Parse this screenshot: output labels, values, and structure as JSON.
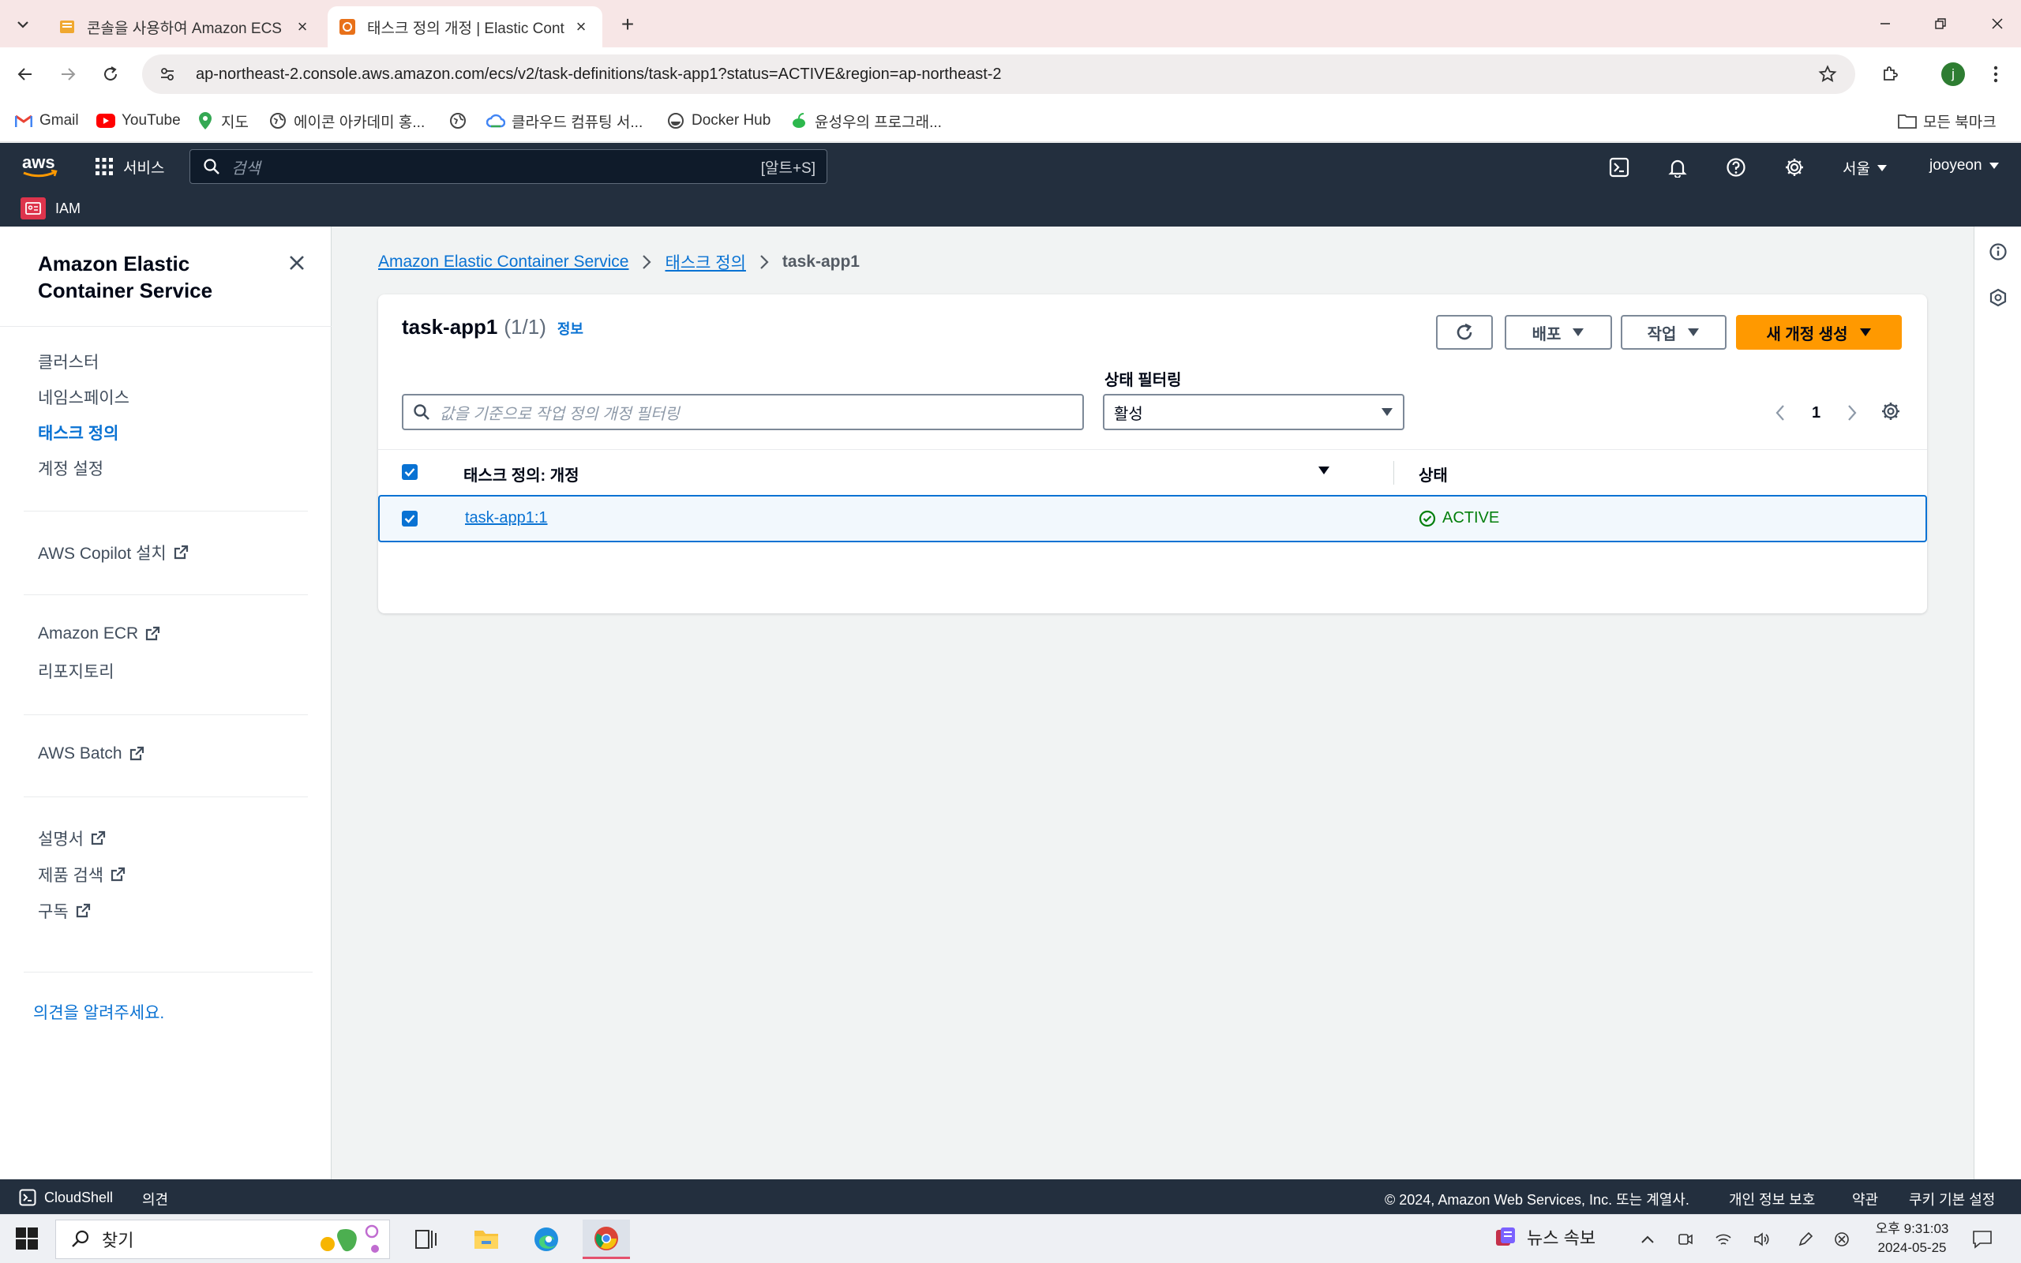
{
  "browser": {
    "tabs": [
      {
        "title": "콘솔을 사용하여 Amazon ECS",
        "active": false
      },
      {
        "title": "태스크 정의 개정 | Elastic Cont",
        "active": true
      }
    ],
    "url": "ap-northeast-2.console.aws.amazon.com/ecs/v2/task-definitions/task-app1?status=ACTIVE&region=ap-northeast-2",
    "profile_initial": "j",
    "bookmarks": [
      "Gmail",
      "YouTube",
      "지도",
      "에이콘 아카데미 홍...",
      "",
      "클라우드 컴퓨팅 서...",
      "Docker Hub",
      "윤성우의 프로그래..."
    ],
    "all_bookmarks": "모든 북마크"
  },
  "aws_nav": {
    "logo": "aws",
    "services": "서비스",
    "search_placeholder": "검색",
    "search_shortcut": "[알트+S]",
    "region": "서울",
    "user": "jooyeon",
    "favorite": "IAM"
  },
  "sidenav": {
    "title": "Amazon Elastic Container Service",
    "items": [
      "클러스터",
      "네임스페이스",
      "태스크 정의",
      "계정 설정"
    ],
    "active_item": "태스크 정의",
    "links": [
      "AWS Copilot 설치",
      "Amazon ECR",
      "리포지토리",
      "AWS Batch",
      "설명서",
      "제품 검색",
      "구독"
    ],
    "feedback": "의견을 알려주세요."
  },
  "breadcrumb": [
    "Amazon Elastic Container Service",
    "태스크 정의",
    "task-app1"
  ],
  "panel": {
    "title": "task-app1",
    "count": "(1/1)",
    "info": "정보",
    "buttons": {
      "deploy": "배포",
      "actions": "작업",
      "create": "새 개정 생성"
    },
    "filter_placeholder": "값을 기준으로 작업 정의 개정 필터링",
    "status_filter_label": "상태 필터링",
    "status_filter_value": "활성",
    "page": "1",
    "columns": [
      "태스크 정의: 개정",
      "상태"
    ],
    "rows": [
      {
        "revision": "task-app1:1",
        "status": "ACTIVE",
        "selected": true
      }
    ]
  },
  "footer": {
    "cloudshell": "CloudShell",
    "feedback": "의견",
    "copyright": "© 2024, Amazon Web Services, Inc. 또는 계열사.",
    "privacy": "개인 정보 보호",
    "terms": "약관",
    "cookies": "쿠키 기본 설정"
  },
  "taskbar": {
    "search": "찾기",
    "news": "뉴스 속보",
    "time": "오후 9:31:03",
    "date": "2024-05-25"
  },
  "colors": {
    "aws_nav": "#232f3e",
    "primary_button": "#ff9900",
    "link": "#0972d3",
    "status_active": "#037f0c"
  }
}
